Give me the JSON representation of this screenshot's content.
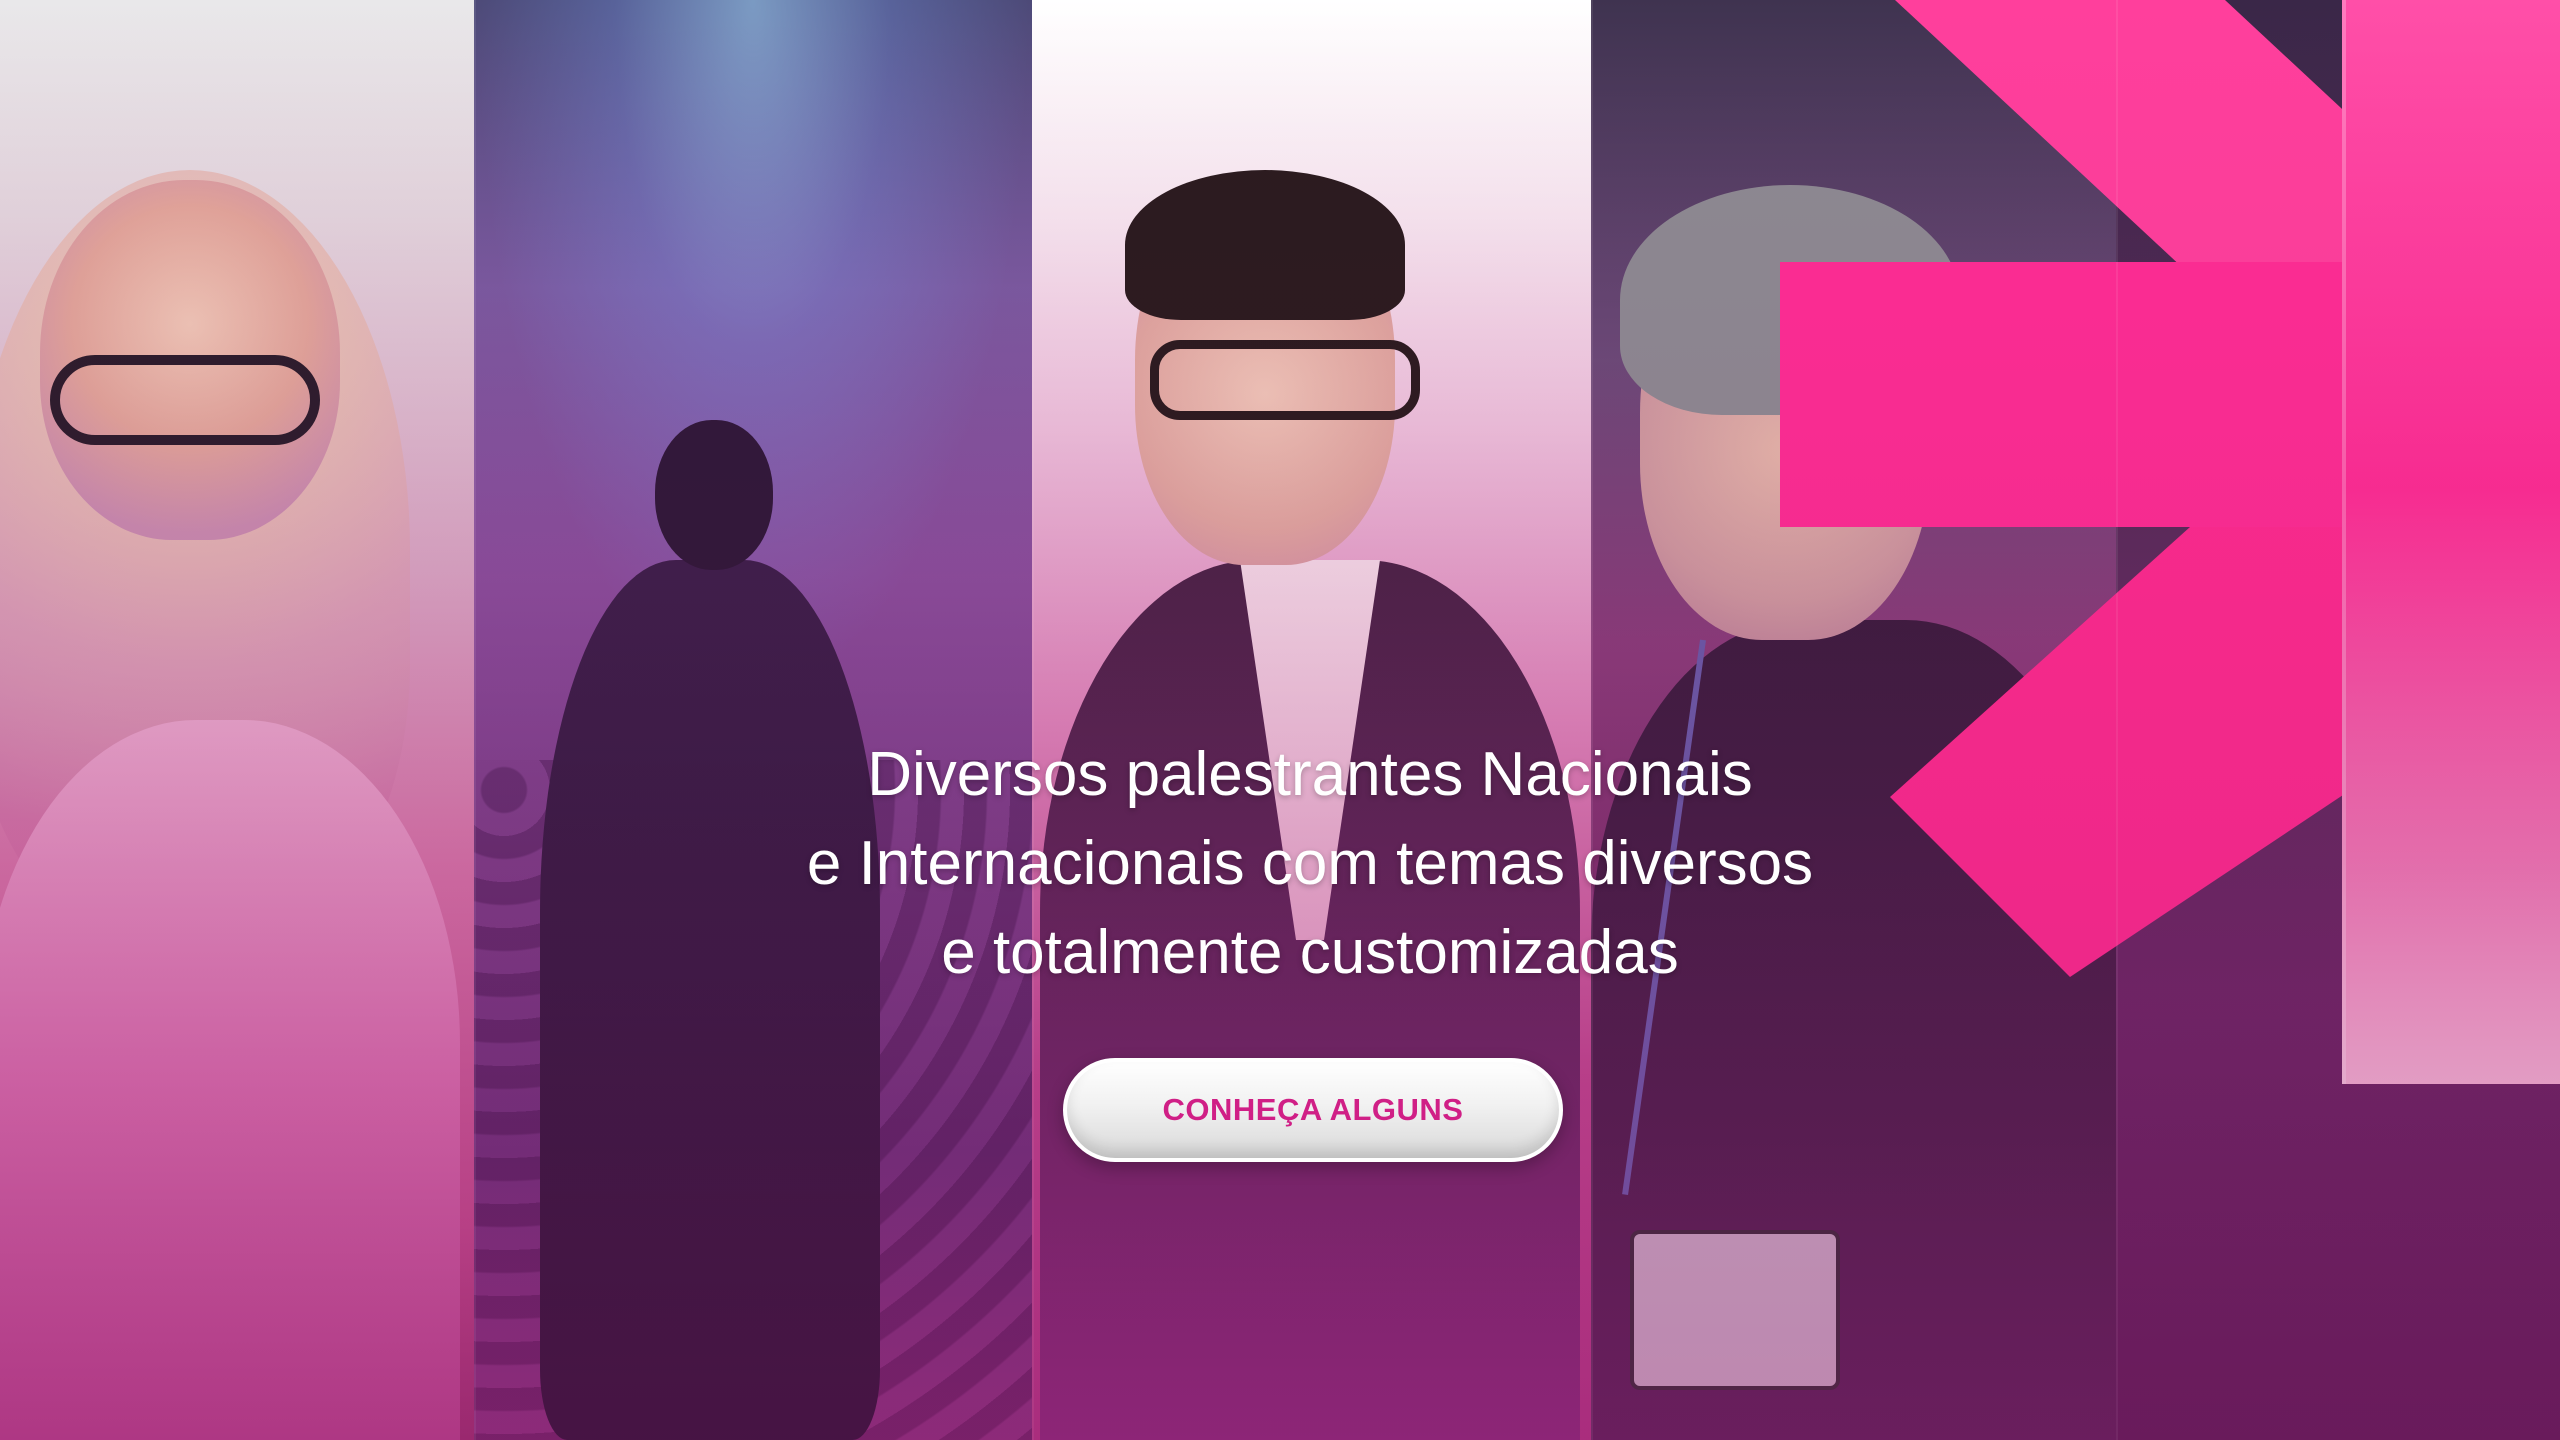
{
  "hero": {
    "headline_lines": [
      "Diversos palestrantes Nacionais",
      "e Internacionais com temas diversos",
      "e totalmente customizadas"
    ],
    "cta_label": "CONHEÇA ALGUNS"
  },
  "colors": {
    "accent_pink": "#ff2d94",
    "cta_text": "#d01f86",
    "text_white": "#ffffff"
  },
  "panels": [
    {
      "name": "speaker-woman-glasses"
    },
    {
      "name": "speaker-on-stage"
    },
    {
      "name": "speaker-man-presenting"
    },
    {
      "name": "speaker-woman-badge"
    },
    {
      "name": "brand-logo-panel"
    }
  ]
}
